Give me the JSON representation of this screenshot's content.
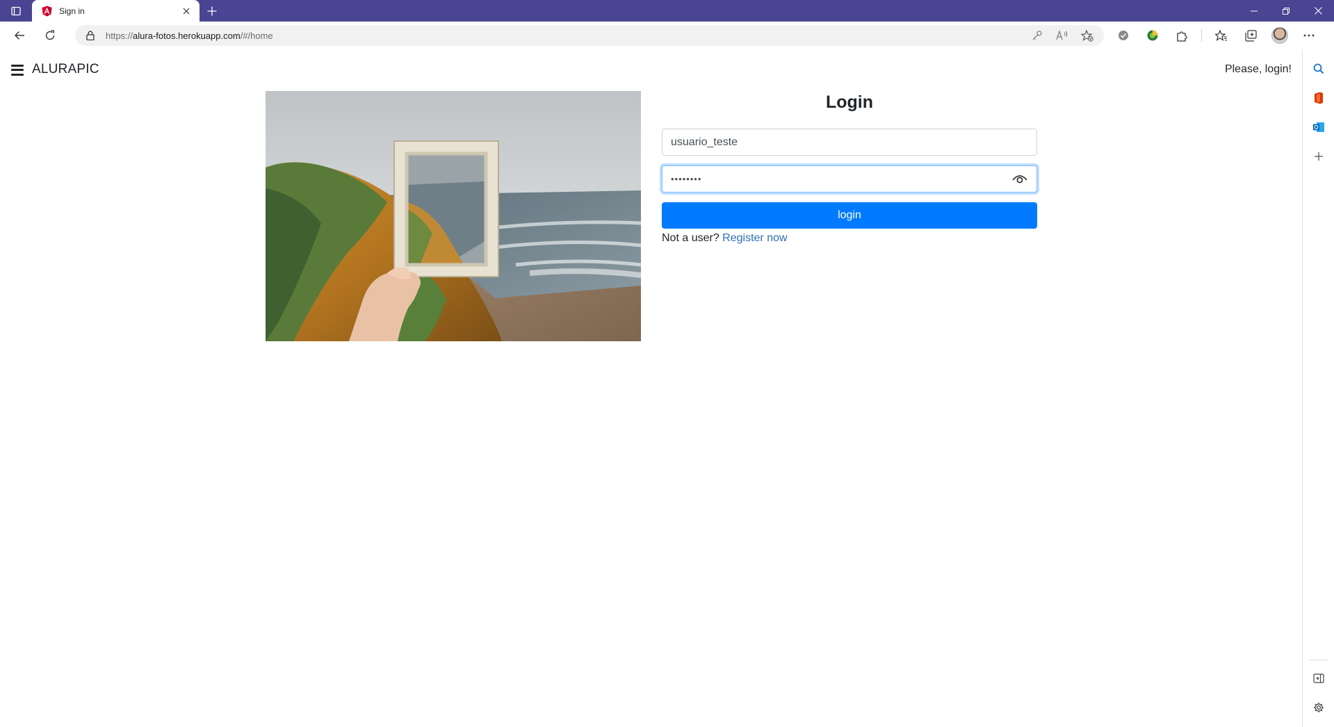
{
  "browser": {
    "tab": {
      "title": "Sign in",
      "favicon": "angular-icon"
    },
    "address": {
      "scheme": "https://",
      "host": "alura-fotos.herokuapp.com",
      "path": "/#/home"
    },
    "colors": {
      "titlebar": "#4a4592",
      "accent": "#007bff"
    }
  },
  "app": {
    "brand": "ALURAPIC",
    "login_hint": "Please, login!"
  },
  "login": {
    "title": "Login",
    "username_value": "usuario_teste",
    "password_value": "••••••••",
    "submit_label": "login",
    "register_prompt": "Not a user?",
    "register_link": "Register now"
  },
  "image": {
    "description": "hand-holding-frame-over-beach-cliff"
  }
}
